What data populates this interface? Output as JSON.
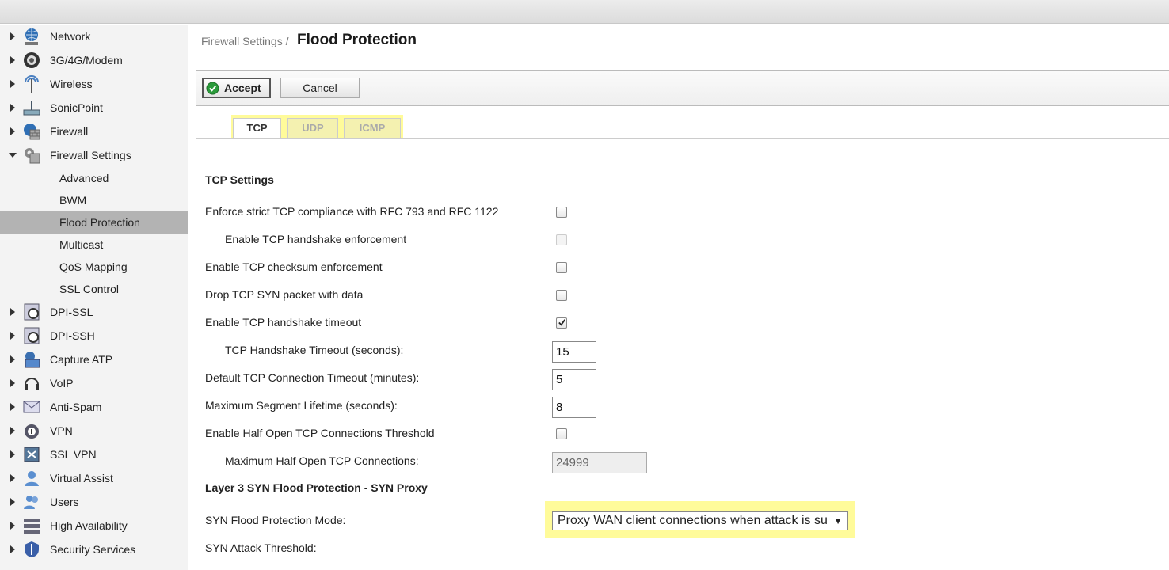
{
  "sidebar": {
    "items": [
      {
        "label": "Network",
        "icon": "globe-icon"
      },
      {
        "label": "3G/4G/Modem",
        "icon": "modem-icon"
      },
      {
        "label": "Wireless",
        "icon": "antenna-icon"
      },
      {
        "label": "SonicPoint",
        "icon": "access-point-icon"
      },
      {
        "label": "Firewall",
        "icon": "firewall-globe-icon"
      },
      {
        "label": "Firewall Settings",
        "icon": "settings-gears-icon"
      }
    ],
    "subitems": [
      "Advanced",
      "BWM",
      "Flood Protection",
      "Multicast",
      "QoS Mapping",
      "SSL Control"
    ],
    "items2": [
      {
        "label": "DPI-SSL",
        "icon": "dpi-lock-icon"
      },
      {
        "label": "DPI-SSH",
        "icon": "dpi-lock-icon"
      },
      {
        "label": "Capture ATP",
        "icon": "capture-shield-icon"
      },
      {
        "label": "VoIP",
        "icon": "headset-icon"
      },
      {
        "label": "Anti-Spam",
        "icon": "envelope-icon"
      },
      {
        "label": "VPN",
        "icon": "vpn-lock-icon"
      },
      {
        "label": "SSL VPN",
        "icon": "ssl-vpn-icon"
      },
      {
        "label": "Virtual Assist",
        "icon": "virtual-assist-icon"
      },
      {
        "label": "Users",
        "icon": "users-icon"
      },
      {
        "label": "High Availability",
        "icon": "server-stack-icon"
      },
      {
        "label": "Security Services",
        "icon": "shield-icon"
      }
    ]
  },
  "header": {
    "breadcrumb": "Firewall Settings /",
    "title": "Flood Protection"
  },
  "toolbar": {
    "accept_label": "Accept",
    "cancel_label": "Cancel"
  },
  "tabs": [
    {
      "label": "TCP",
      "active": true
    },
    {
      "label": "UDP",
      "active": false
    },
    {
      "label": "ICMP",
      "active": false
    }
  ],
  "tcp": {
    "section_title": "TCP Settings",
    "rows": {
      "strict_rfc": {
        "label": "Enforce strict TCP compliance with RFC 793 and RFC 1122",
        "checked": false
      },
      "handshake_enforce": {
        "label": "Enable TCP handshake enforcement",
        "checked": false
      },
      "checksum": {
        "label": "Enable TCP checksum enforcement",
        "checked": false
      },
      "drop_syn": {
        "label": "Drop TCP SYN packet with data",
        "checked": false
      },
      "handshake_timeout_enable": {
        "label": "Enable TCP handshake timeout",
        "checked": true
      },
      "handshake_timeout": {
        "label": "TCP Handshake Timeout (seconds):",
        "value": "15"
      },
      "conn_timeout": {
        "label": "Default TCP Connection Timeout (minutes):",
        "value": "5"
      },
      "msl": {
        "label": "Maximum Segment Lifetime (seconds):",
        "value": "8"
      },
      "half_open_enable": {
        "label": "Enable Half Open TCP Connections Threshold",
        "checked": false
      },
      "half_open_max": {
        "label": "Maximum Half Open TCP Connections:",
        "value": "24999"
      }
    }
  },
  "syn": {
    "section_title": "Layer 3 SYN Flood Protection - SYN Proxy",
    "mode_label": "SYN Flood Protection Mode:",
    "mode_value": "Proxy WAN client connections when attack is su",
    "threshold_label": "SYN Attack Threshold:"
  }
}
